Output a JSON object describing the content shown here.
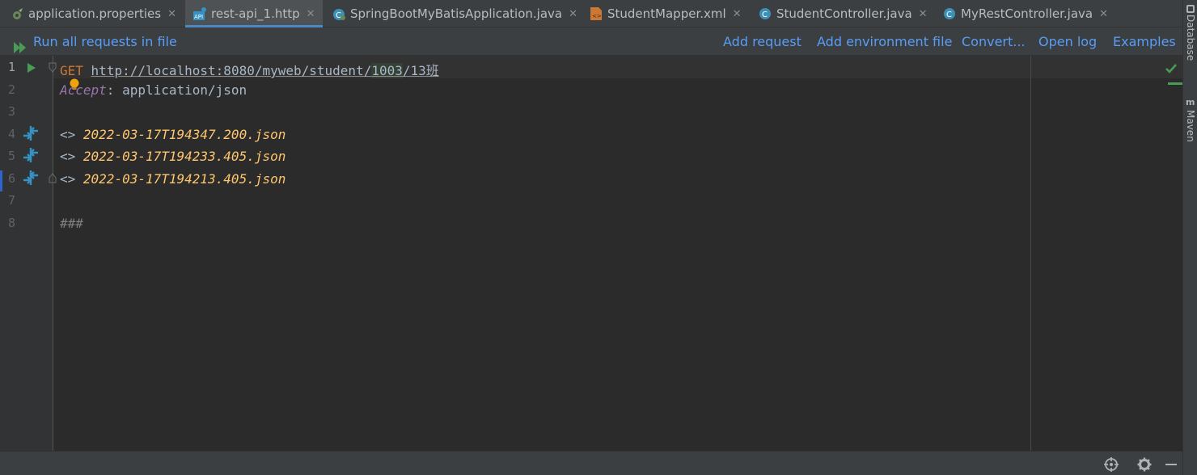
{
  "tabs": [
    {
      "label": "application.properties",
      "icon": "spring-properties-icon"
    },
    {
      "label": "rest-api_1.http",
      "icon": "api-file-icon"
    },
    {
      "label": "SpringBootMyBatisApplication.java",
      "icon": "spring-boot-class-icon"
    },
    {
      "label": "StudentMapper.xml",
      "icon": "xml-file-icon"
    },
    {
      "label": "StudentController.java",
      "icon": "java-class-icon"
    },
    {
      "label": "MyRestController.java",
      "icon": "java-class-icon"
    }
  ],
  "toolbar": {
    "run_all": "Run all requests in file",
    "add_request": "Add request",
    "add_env": "Add environment file",
    "convert": "Convert...",
    "open_log": "Open log",
    "examples": "Examples"
  },
  "editor": {
    "line_numbers": [
      "1",
      "2",
      "3",
      "4",
      "5",
      "6",
      "7",
      "8"
    ],
    "line1": {
      "method": "GET",
      "url_prefix": "http://localhost:8080/myweb/student/",
      "url_highlight": "1003",
      "url_suffix": "/13班"
    },
    "line2": {
      "header_name": "Accept",
      "header_sep": ": ",
      "header_value": "application/json"
    },
    "responses": [
      {
        "prefix": "<> ",
        "file": "2022-03-17T194347.200.json"
      },
      {
        "prefix": "<> ",
        "file": "2022-03-17T194233.405.json"
      },
      {
        "prefix": "<> ",
        "file": "2022-03-17T194213.405.json"
      }
    ],
    "line8": "###"
  },
  "right_tools": {
    "database": "Database",
    "maven": "Maven"
  },
  "colors": {
    "accent": "#4a88c7",
    "link": "#589df6",
    "run_green": "#499c54",
    "background": "#2b2b2b"
  }
}
